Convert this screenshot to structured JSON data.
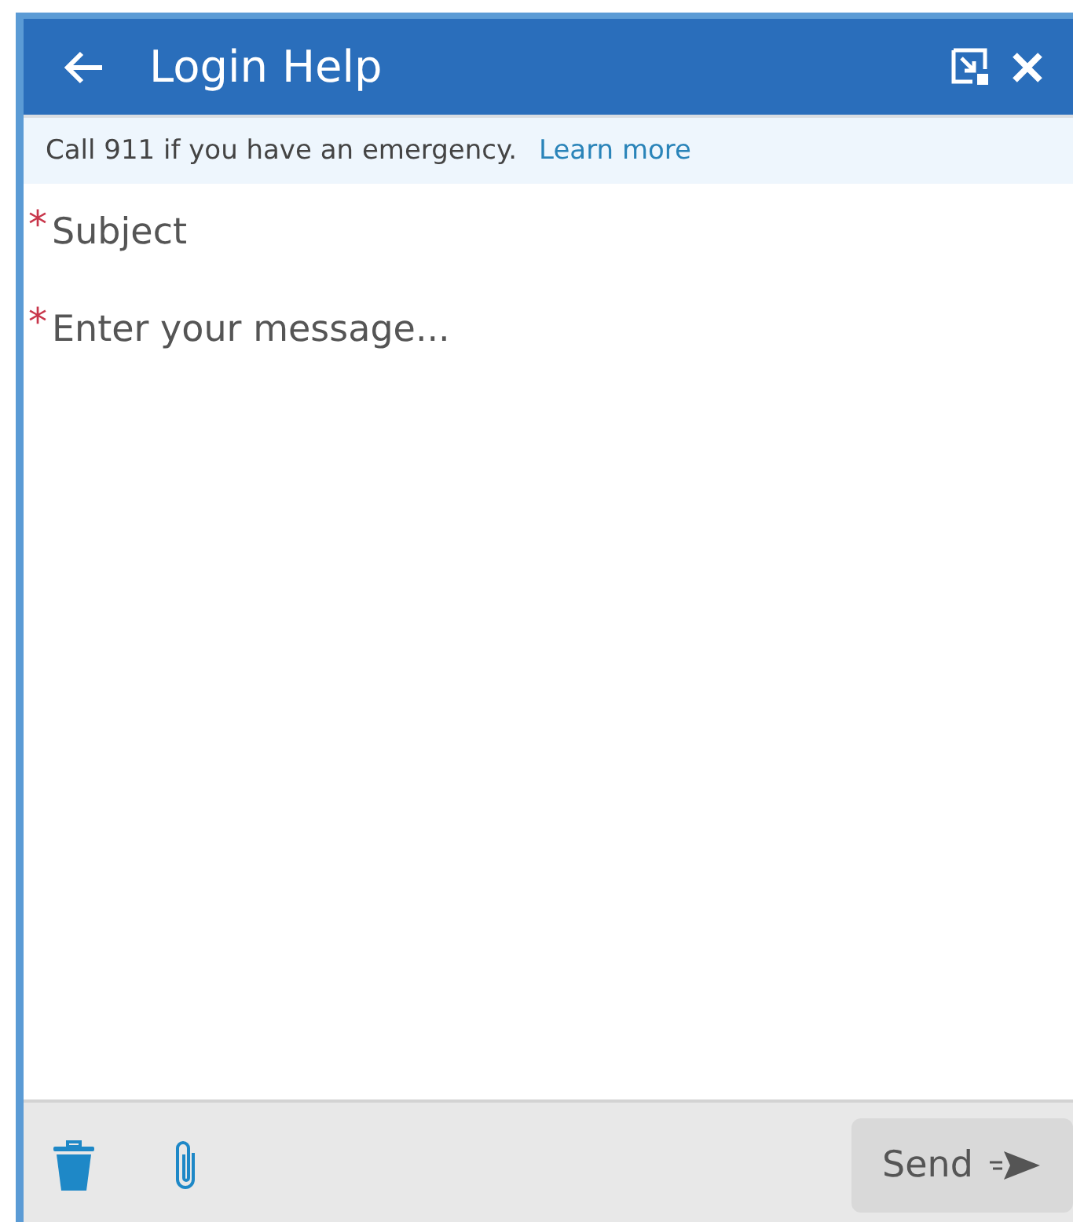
{
  "header": {
    "title": "Login Help"
  },
  "notice": {
    "text": "Call 911 if you have an emergency.",
    "link": "Learn more"
  },
  "fields": [
    {
      "kind": "line",
      "required_mark": "*",
      "placeholder": "Subject"
    },
    {
      "kind": "area",
      "required_mark": "*",
      "placeholder": "Enter your message..."
    }
  ],
  "footer": {
    "send": {
      "label": "Send",
      "disabled": true
    }
  }
}
